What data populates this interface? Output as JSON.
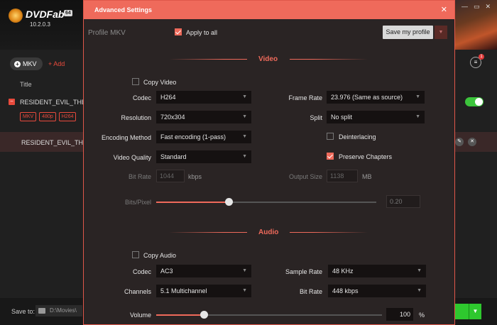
{
  "app": {
    "logo_name": "DVDFab",
    "logo_badge": "64",
    "version": "10.2.0.3",
    "source_button": "MKV",
    "add_label": "Add",
    "title_header": "Title",
    "title_row_1": "RESIDENT_EVIL_THE_",
    "title_row_2": "RESIDENT_EVIL_THE_",
    "tags": [
      "MKV",
      "480p",
      "H264"
    ],
    "list_badge": "1",
    "save_to_label": "Save to:",
    "save_to_path": "D:\\Movies\\"
  },
  "modal": {
    "title": "Advanced Settings",
    "profile_label": "Profile MKV",
    "apply_all_label": "Apply to all",
    "apply_all_checked": true,
    "save_profile_label": "Save my profile"
  },
  "video": {
    "section_title": "Video",
    "copy_video_label": "Copy Video",
    "copy_video_checked": false,
    "codec_label": "Codec",
    "codec_value": "H264",
    "frame_rate_label": "Frame Rate",
    "frame_rate_value": "23.976 (Same as source)",
    "resolution_label": "Resolution",
    "resolution_value": "720x304",
    "split_label": "Split",
    "split_value": "No split",
    "encoding_label": "Encoding Method",
    "encoding_value": "Fast encoding (1-pass)",
    "deinterlacing_label": "Deinterlacing",
    "deinterlacing_checked": false,
    "quality_label": "Video Quality",
    "quality_value": "Standard",
    "preserve_chapters_label": "Preserve Chapters",
    "preserve_chapters_checked": true,
    "bitrate_label": "Bit Rate",
    "bitrate_value": "1044",
    "bitrate_unit": "kbps",
    "output_size_label": "Output Size",
    "output_size_value": "1138",
    "output_size_unit": "MB",
    "bits_pixel_label": "Bits/Pixel",
    "bits_pixel_value": "0.20",
    "bits_pixel_slider_fraction": 0.33
  },
  "audio": {
    "section_title": "Audio",
    "copy_audio_label": "Copy Audio",
    "copy_audio_checked": false,
    "codec_label": "Codec",
    "codec_value": "AC3",
    "sample_rate_label": "Sample Rate",
    "sample_rate_value": "48 KHz",
    "channels_label": "Channels",
    "channels_value": "5.1 Multichannel",
    "bitrate_label": "Bit Rate",
    "bitrate_value": "448 kbps",
    "volume_label": "Volume",
    "volume_value": "100",
    "volume_unit": "%",
    "volume_slider_fraction": 0.21
  },
  "colors": {
    "accent": "#ef6a5b",
    "modal_bg": "#2a2424",
    "toggle_on": "#3cc43c",
    "start_button": "#2ec82e"
  }
}
